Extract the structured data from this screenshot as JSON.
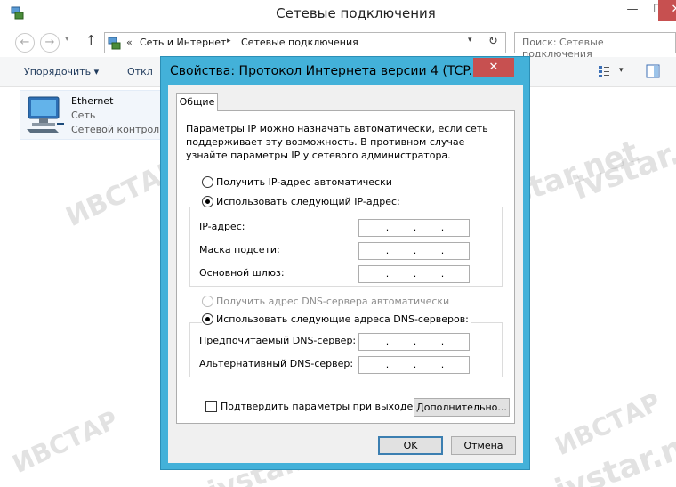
{
  "window": {
    "title": "Сетевые подключения",
    "minimize_glyph": "—",
    "maximize_glyph": "☐",
    "close_glyph": "✕"
  },
  "navigation": {
    "back_glyph": "←",
    "forward_glyph": "→",
    "recent_glyph": "▾",
    "up_glyph": "↑",
    "address_chevron": "«",
    "breadcrumbs": [
      "Сеть и Интернет",
      "Сетевые подключения"
    ],
    "crumb_separator": "▸",
    "dropdown_glyph": "▾",
    "refresh_glyph": "↻",
    "search_placeholder": "Поиск: Сетевые подключения"
  },
  "commandbar": {
    "organize_label": "Упорядочить ▾",
    "disable_label": "Откл",
    "view_dropdown": "▾"
  },
  "connection": {
    "name": "Ethernet",
    "type": "Сеть",
    "description": "Сетевой контрол"
  },
  "dialog": {
    "title": "Свойства: Протокол Интернета версии 4 (TCP...",
    "close_glyph": "✕",
    "tab_general": "Общие",
    "info_text": "Параметры IP можно назначать автоматически, если сеть поддерживает эту возможность. В противном случае узнайте параметры IP у сетевого администратора.",
    "radio_auto_ip": "Получить IP-адрес автоматически",
    "radio_manual_ip": "Использовать следующий IP-адрес:",
    "label_ip": "IP-адрес:",
    "label_mask": "Маска подсети:",
    "label_gateway": "Основной шлюз:",
    "radio_auto_dns": "Получить адрес DNS-сервера автоматически",
    "radio_manual_dns": "Использовать следующие адреса DNS-серверов:",
    "label_dns_pref": "Предпочитаемый DNS-сервер:",
    "label_dns_alt": "Альтернативный DNS-сервер:",
    "ip_dots": [
      ".",
      ".",
      "."
    ],
    "checkbox_validate": "Подтвердить параметры при выходе",
    "advanced_button": "Дополнительно...",
    "ok_button": "OK",
    "cancel_button": "Отмена"
  },
  "watermarks": [
    "ivstar.net",
    "ИВСТАР",
    "ivstar.net",
    "ИВСТАР",
    "ivstar.net",
    "ИВСТАР",
    "ivstar.net"
  ],
  "colors": {
    "dialog_frame": "#43b1d9",
    "close_red": "#c75050",
    "ok_border": "#3c7fb1"
  }
}
